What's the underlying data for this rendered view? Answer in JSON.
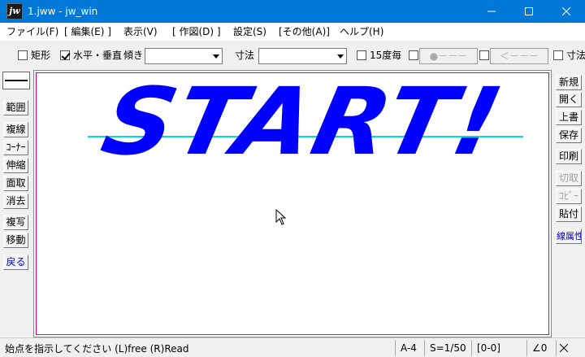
{
  "window": {
    "app_icon_text": "jw",
    "title": "1.jww - jw_win"
  },
  "menu": {
    "items": [
      "ファイル(F)",
      "[ 編集(E) ]",
      "表示(V)",
      "[ 作図(D) ]",
      "設定(S)",
      "[その他(A)]",
      "ヘルプ(H)"
    ]
  },
  "toolbar": {
    "rect_label": "矩形",
    "rect_checked": false,
    "hv_label": "水平・垂直",
    "hv_checked": true,
    "tilt_label": "傾き",
    "tilt_value": "",
    "dim_label": "寸法",
    "dim_value": "",
    "deg15_label": "15度毎",
    "deg15_checked": false,
    "line_btn1": "●－－－",
    "line_btn2": "＜－－－",
    "dim2_label": "寸法"
  },
  "left_tools": [
    "範囲",
    "複線",
    "ｺｰﾅｰ",
    "伸縮",
    "面取",
    "消去",
    "複写",
    "移動",
    "戻る"
  ],
  "right_tools": [
    "新規",
    "開く",
    "上書",
    "保存",
    "印刷",
    "切取",
    "ｺﾋﾟｰ",
    "貼付",
    "線属性"
  ],
  "canvas": {
    "drawn_text": "START!"
  },
  "status": {
    "message": "始点を指示してください (L)free (R)Read",
    "paper": "A-4",
    "scale": "S=1/50",
    "layer": "[0-0]",
    "angle": "∠0"
  },
  "colors": {
    "titlebar": "#0078d7",
    "drawn_text": "#0000ff",
    "guide_line": "#00d8e8",
    "border": "#c000c0"
  }
}
